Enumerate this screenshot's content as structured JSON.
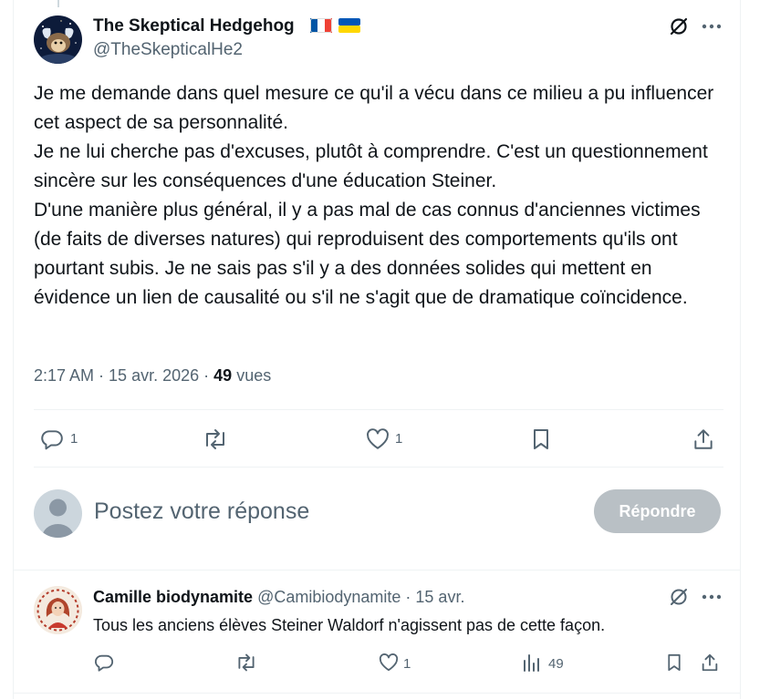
{
  "tweet": {
    "author_name": "The Skeptical Hedgehog",
    "author_handle": "@TheSkepticalHe2",
    "body": "Je me demande dans quel mesure ce qu'il a vécu dans ce milieu a pu influencer cet aspect de sa personnalité.\nJe ne lui cherche pas d'excuses, plutôt à comprendre. C'est un questionnement sincère sur les conséquences d'une éducation Steiner.\nD'une manière plus général, il y a pas mal de cas connus d'anciennes victimes (de faits de diverses natures) qui reproduisent des comportements qu'ils ont pourtant subis. Je ne sais pas s'il y a des données solides qui mettent en évidence un lien de causalité ou s'il ne s'agit que de dramatique coïncidence.",
    "time": "2:17 AM",
    "date": "15 avr. 2026",
    "views_count": "49",
    "views_label": "vues",
    "reply_count": "1",
    "like_count": "1",
    "icons": [
      "grok-icon",
      "more-icon",
      "reply-icon",
      "retweet-icon",
      "like-icon",
      "bookmark-icon",
      "share-icon"
    ]
  },
  "composer": {
    "placeholder": "Postez votre réponse",
    "reply_button": "Répondre"
  },
  "reply": {
    "author_name": "Camille biodynamite",
    "author_handle": "@Camibiodynamite",
    "date": "15 avr.",
    "body": "Tous les anciens élèves Steiner Waldorf n'agissent pas de cette façon.",
    "like_count": "1",
    "views_count": "49"
  },
  "colors": {
    "muted": "#536471",
    "divider": "#eff3f4",
    "button_disabled": "#b9c0c5",
    "flag_fr": [
      "#0055a4",
      "#ffffff",
      "#ef4135"
    ],
    "flag_ua": [
      "#0057b7",
      "#ffd700"
    ]
  }
}
